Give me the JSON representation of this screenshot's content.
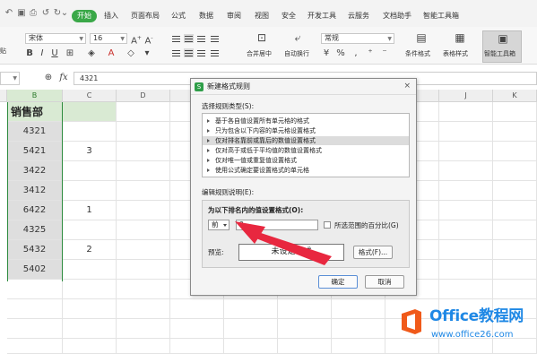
{
  "menubar": {
    "start_tab": "开始",
    "tabs": [
      "插入",
      "页面布局",
      "公式",
      "数据",
      "审阅",
      "视图",
      "安全",
      "开发工具",
      "云服务",
      "文档助手",
      "智能工具箱"
    ]
  },
  "ribbon": {
    "font_name": "宋体",
    "font_size": "16",
    "number_format": "常规",
    "labels": {
      "merge_center": "合并居中",
      "auto_wrap": "自动换行",
      "cond_format": "条件格式",
      "table_style": "表格样式",
      "smart_toolbox": "智能工具箱",
      "paste_fragment": "贴"
    }
  },
  "formula_bar": {
    "fx": "fx",
    "value": "4321"
  },
  "sheet": {
    "columns": [
      "B",
      "C",
      "D",
      "E",
      "F",
      "G",
      "H",
      "I",
      "J",
      "K"
    ],
    "header": "销售部",
    "rows": [
      {
        "b": "4321",
        "c": ""
      },
      {
        "b": "5421",
        "c": "3"
      },
      {
        "b": "3422",
        "c": ""
      },
      {
        "b": "3412",
        "c": ""
      },
      {
        "b": "6422",
        "c": "1"
      },
      {
        "b": "4325",
        "c": ""
      },
      {
        "b": "5432",
        "c": "2"
      },
      {
        "b": "5402",
        "c": ""
      }
    ]
  },
  "dialog": {
    "title": "新建格式规则",
    "close": "×",
    "select_rule_type_label": "选择规则类型(S):",
    "rule_types": [
      "基于各自值设置所有单元格的格式",
      "只为包含以下内容的单元格设置格式",
      "仅对排名靠前或靠后的数值设置格式",
      "仅对高于或低于平均值的数值设置格式",
      "仅对唯一值或重复值设置格式",
      "使用公式确定要设置格式的单元格"
    ],
    "selected_rule_index": 2,
    "edit_desc_label": "编辑规则说明(E):",
    "format_values_label": "为以下排名内的值设置格式(O):",
    "top_bottom_value": "前",
    "rank_value": "3",
    "percent_label": "所选范围的百分比(G)",
    "percent_checked": false,
    "preview_label": "预览:",
    "preview_text": "未设定格式",
    "format_button": "格式(F)...",
    "ok_button": "确定",
    "cancel_button": "取消"
  },
  "annotation": {
    "arrow_color": "#e8273f"
  },
  "watermark": {
    "title": "Office教程网",
    "url": "www.office26.com"
  },
  "colors": {
    "start_tab": "#3aa848",
    "header_cell_bg": "#d9ead3",
    "selected_column_cells": "#dedede",
    "watermark_blue": "#1f88e5",
    "watermark_orange": "#f05a1a"
  }
}
